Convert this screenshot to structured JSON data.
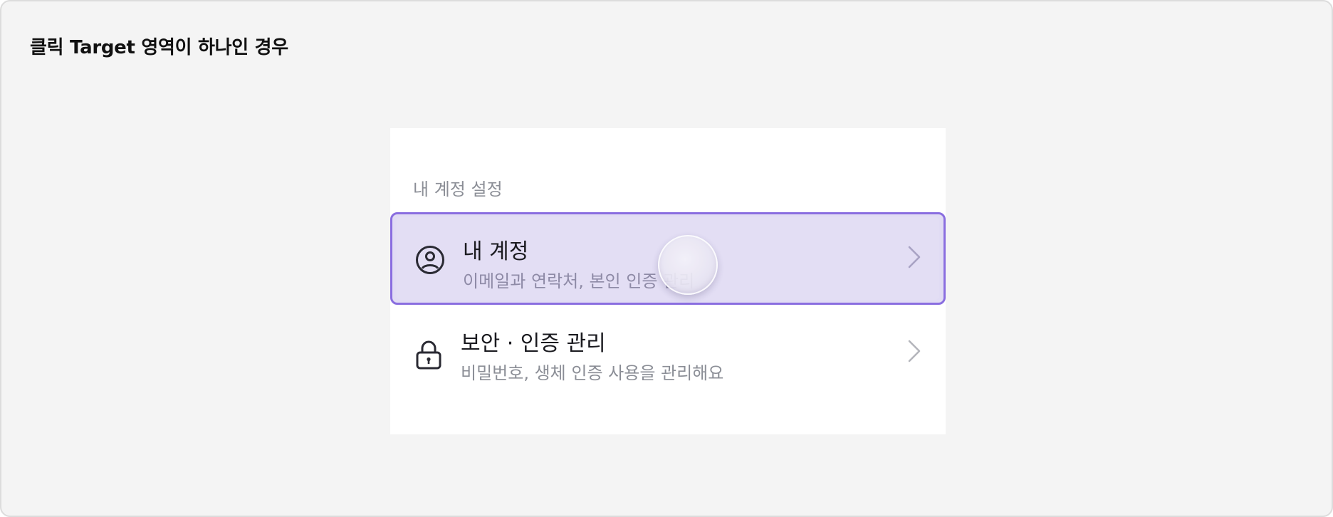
{
  "page": {
    "title": "클릭 Target 영역이 하나인 경우"
  },
  "settings": {
    "section_label": "내 계정 설정",
    "items": [
      {
        "title": "내 계정",
        "description": "이메일과 연락처, 본인 인증 관리",
        "icon": "user-circle-icon",
        "state": "pressed"
      },
      {
        "title": "보안 · 인증 관리",
        "description": "비밀번호, 생체 인증 사용을 관리해요",
        "icon": "lock-icon",
        "state": "default"
      }
    ]
  },
  "colors": {
    "background": "#f4f4f4",
    "card": "#ffffff",
    "highlight_fill": "#e1dcf4",
    "highlight_border": "#8a6ee0",
    "secondary_text": "#8b8e96",
    "primary_text": "#1a1a1f"
  }
}
